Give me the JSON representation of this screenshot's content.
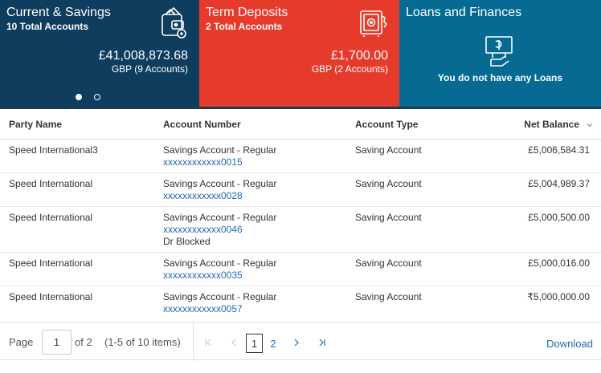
{
  "cards": {
    "current_savings": {
      "title": "Current & Savings",
      "subtitle": "10 Total Accounts",
      "amount": "£41,008,873.68",
      "amount_sub": "GBP (9 Accounts)",
      "icon": "wallet-icon",
      "color": "#0e3d5e"
    },
    "term_deposits": {
      "title": "Term Deposits",
      "subtitle": "2 Total Accounts",
      "amount": "£1,700.00",
      "amount_sub": "GBP (2 Accounts)",
      "icon": "safe-icon",
      "color": "#e63a2b"
    },
    "loans": {
      "title": "Loans and Finances",
      "message": "You do not have any Loans",
      "icon": "loan-board-icon",
      "color": "#076a92"
    },
    "carousel": {
      "active_index": 0,
      "count": 2
    }
  },
  "table": {
    "headers": {
      "party": "Party Name",
      "account": "Account Number",
      "type": "Account Type",
      "balance": "Net Balance"
    },
    "rows": [
      {
        "party": "Speed International3",
        "account_name": "Savings Account - Regular",
        "account_number": "xxxxxxxxxxxx0015",
        "extra": "",
        "type": "Saving Account",
        "balance": "£5,006,584.31"
      },
      {
        "party": "Speed International",
        "account_name": "Savings Account - Regular",
        "account_number": "xxxxxxxxxxxx0028",
        "extra": "",
        "type": "Saving Account",
        "balance": "£5,004,989.37"
      },
      {
        "party": "Speed International",
        "account_name": "Savings Account - Regular",
        "account_number": "xxxxxxxxxxxx0046",
        "extra": "Dr Blocked",
        "type": "Saving Account",
        "balance": "£5,000,500.00"
      },
      {
        "party": "Speed International",
        "account_name": "Savings Account - Regular",
        "account_number": "xxxxxxxxxxxx0035",
        "extra": "",
        "type": "Saving Account",
        "balance": "£5,000,016.00"
      },
      {
        "party": "Speed International",
        "account_name": "Savings Account - Regular",
        "account_number": "xxxxxxxxxxxx0057",
        "extra": "",
        "type": "Saving Account",
        "balance": "₹5,000,000.00"
      }
    ]
  },
  "pager": {
    "page_label": "Page",
    "page_value": "1",
    "of_label": "of 2",
    "range_label": "(1-5 of 10 items)",
    "pages": [
      "1",
      "2"
    ],
    "current_page": "1",
    "download_label": "Download",
    "link_color": "#1f69b3"
  }
}
